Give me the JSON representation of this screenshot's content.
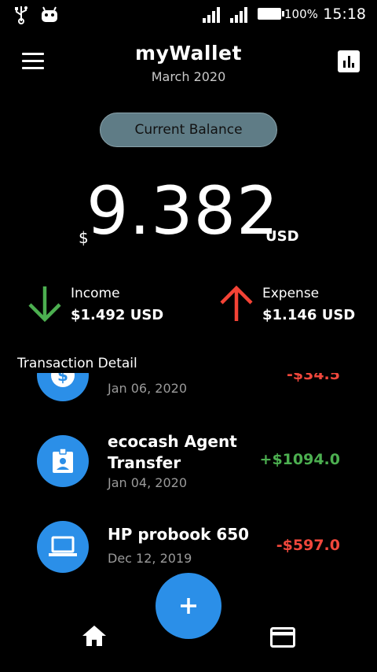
{
  "status_bar": {
    "battery": "100%",
    "time": "15:18",
    "icons": [
      "usb-icon",
      "android-icon",
      "signal-icon",
      "signal-icon",
      "battery-icon"
    ]
  },
  "header": {
    "title": "myWallet",
    "subtitle": "March 2020",
    "left_icon": "menu-icon",
    "right_icon": "bar-chart-icon"
  },
  "balance": {
    "label": "Current Balance",
    "currency_symbol": "$",
    "amount": "9.382",
    "unit": "USD"
  },
  "income": {
    "label": "Income",
    "value": "$1.492 USD",
    "icon": "arrow-down-icon",
    "color": "#4caf50"
  },
  "expense": {
    "label": "Expense",
    "value": "$1.146 USD",
    "icon": "arrow-up-icon",
    "color": "#f44336"
  },
  "transactions": {
    "title": "Transaction Detail",
    "items": [
      {
        "name": "",
        "date": "Jan 06, 2020",
        "amount": "-$34.5",
        "type": "expense",
        "icon": "dollar-icon"
      },
      {
        "name": "ecocash Agent Transfer",
        "date": "Jan 04, 2020",
        "amount": "+$1094.0",
        "type": "income",
        "icon": "badge-icon"
      },
      {
        "name": "HP probook 650",
        "date": "Dec 12, 2019",
        "amount": "-$597.0",
        "type": "expense",
        "icon": "laptop-icon"
      }
    ]
  },
  "bottom_nav": {
    "fab_icon": "plus-icon",
    "left_icon": "home-icon",
    "right_icon": "credit-card-icon"
  },
  "colors": {
    "accent": "#2b8fe8",
    "pill": "#5f7c86",
    "positive": "#4caf50",
    "negative": "#f0473c"
  }
}
